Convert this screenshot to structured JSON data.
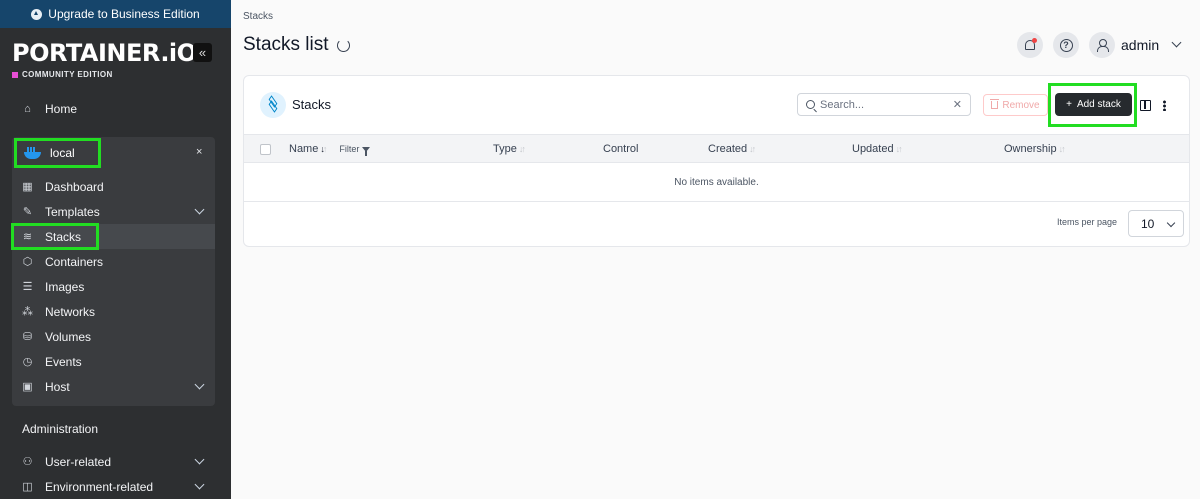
{
  "upgrade_banner": "Upgrade to Business Edition",
  "brand": {
    "logo": "PORTAINER.iO",
    "edition": "COMMUNITY EDITION"
  },
  "sidebar": {
    "home": "Home",
    "environment": {
      "name": "local",
      "close": "×"
    },
    "env_items": [
      {
        "label": "Dashboard",
        "icon": "dashboard-icon"
      },
      {
        "label": "Templates",
        "icon": "templates-icon"
      },
      {
        "label": "Stacks",
        "icon": "stacks-icon"
      },
      {
        "label": "Containers",
        "icon": "containers-icon"
      },
      {
        "label": "Images",
        "icon": "images-icon"
      },
      {
        "label": "Networks",
        "icon": "networks-icon"
      },
      {
        "label": "Volumes",
        "icon": "volumes-icon"
      },
      {
        "label": "Events",
        "icon": "events-icon"
      },
      {
        "label": "Host",
        "icon": "host-icon"
      }
    ],
    "admin_section": "Administration",
    "admin_items": [
      {
        "label": "User-related"
      },
      {
        "label": "Environment-related"
      }
    ]
  },
  "header": {
    "breadcrumb": "Stacks",
    "title": "Stacks list",
    "username": "admin"
  },
  "card": {
    "title": "Stacks",
    "search_placeholder": "Search...",
    "remove_label": "Remove",
    "add_label": "Add stack",
    "columns": [
      "Name",
      "Type",
      "Control",
      "Created",
      "Updated",
      "Ownership"
    ],
    "filter_label": "Filter",
    "empty_message": "No items available.",
    "items_per_page_label": "Items per page",
    "items_per_page_value": "10"
  },
  "colors": {
    "sidebar_bg": "#2d2f31",
    "banner_bg": "#16456b",
    "accent_highlight": "#22dd22",
    "primary_button": "#262a2e"
  }
}
